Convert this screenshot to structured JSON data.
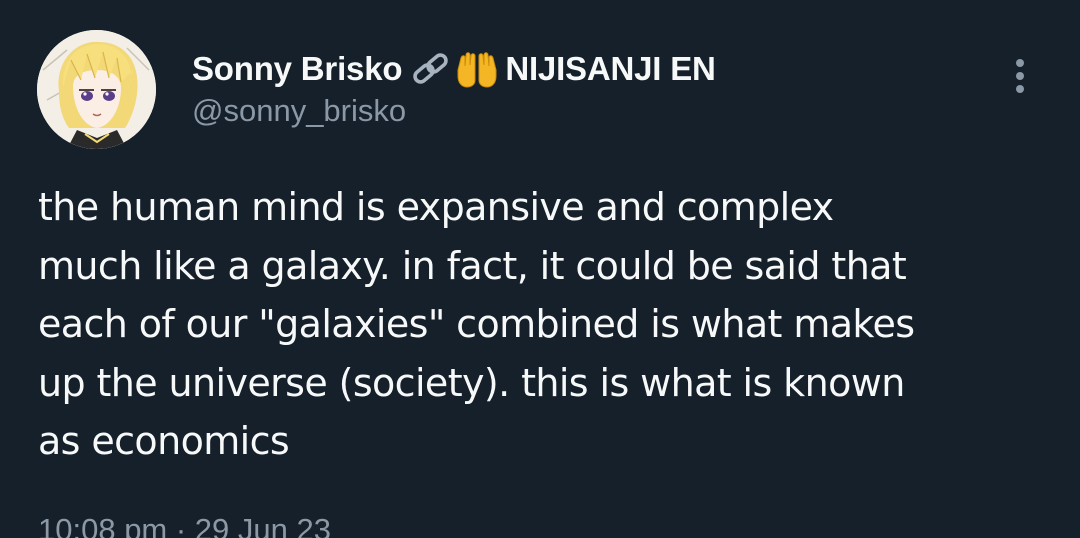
{
  "author": {
    "display_name": "Sonny Brisko",
    "emoji_icons": [
      "link-icon",
      "raised-hands-icon"
    ],
    "affiliation": "NIJISANJI EN",
    "handle": "@sonny_brisko"
  },
  "tweet": {
    "text": "the human mind is expansive and complex\nmuch like a galaxy. in fact, it could be said that\neach of our \"galaxies\" combined is what makes\nup the universe (society). this is what is known\nas economics",
    "timestamp": "10:08 pm · 29 Jun 23"
  },
  "colors": {
    "background": "#15202b",
    "text_primary": "#f7f9f9",
    "text_secondary": "#8b98a5",
    "hands_emoji": "#f5b625"
  }
}
